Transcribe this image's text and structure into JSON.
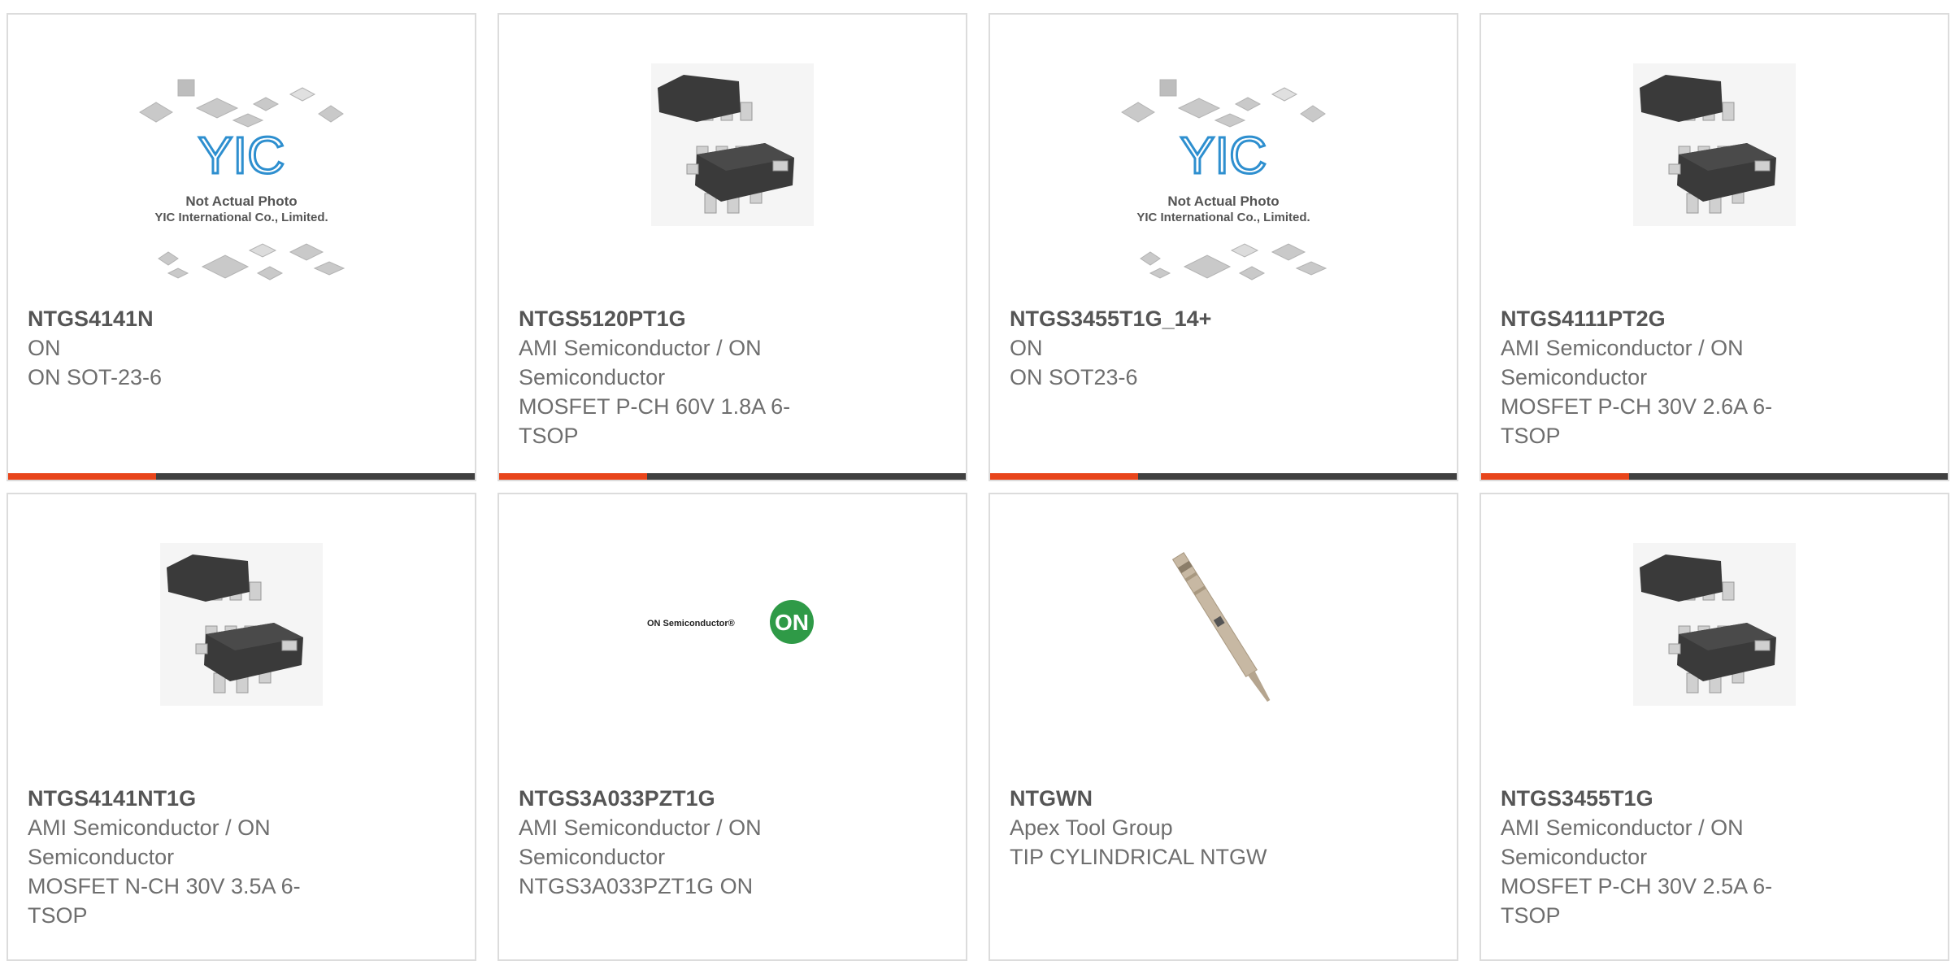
{
  "colors": {
    "accent": "#e8451b",
    "bar": "#404040",
    "border": "#dcdcdc",
    "text": "#6e6e6e"
  },
  "products": [
    {
      "part": "NTGS4141N",
      "manufacturer": "ON",
      "description": "ON SOT-23-6",
      "image": "yic-placeholder",
      "yic_title": "Not Actual Photo",
      "yic_sub": "YIC International Co., Limited.",
      "yic_logo": "YIC"
    },
    {
      "part": "NTGS5120PT1G",
      "manufacturer": "AMI Semiconductor / ON Semiconductor",
      "description": "MOSFET P-CH 60V 1.8A 6-TSOP",
      "image": "tsop6-chip"
    },
    {
      "part": "NTGS3455T1G_14+",
      "manufacturer": "ON",
      "description": "ON SOT23-6",
      "image": "yic-placeholder",
      "yic_title": "Not Actual Photo",
      "yic_sub": "YIC International Co., Limited.",
      "yic_logo": "YIC"
    },
    {
      "part": "NTGS4111PT2G",
      "manufacturer": "AMI Semiconductor / ON Semiconductor",
      "description": "MOSFET P-CH 30V 2.6A 6-TSOP",
      "image": "tsop6-chip"
    },
    {
      "part": "NTGS4141NT1G",
      "manufacturer": "AMI Semiconductor / ON Semiconductor",
      "description": "MOSFET N-CH 30V 3.5A 6-TSOP",
      "image": "tsop6-chip"
    },
    {
      "part": "NTGS3A033PZT1G",
      "manufacturer": "AMI Semiconductor / ON Semiconductor",
      "description": "NTGS3A033PZT1G ON",
      "image": "on-semi-logo",
      "logo_text": "ON Semiconductor®",
      "logo_badge": "ON"
    },
    {
      "part": "NTGWN",
      "manufacturer": "Apex Tool Group",
      "description": "TIP CYLINDRICAL NTGW",
      "image": "soldering-tip"
    },
    {
      "part": "NTGS3455T1G",
      "manufacturer": "AMI Semiconductor / ON Semiconductor",
      "description": "MOSFET P-CH 30V 2.5A 6-TSOP",
      "image": "tsop6-chip"
    }
  ]
}
